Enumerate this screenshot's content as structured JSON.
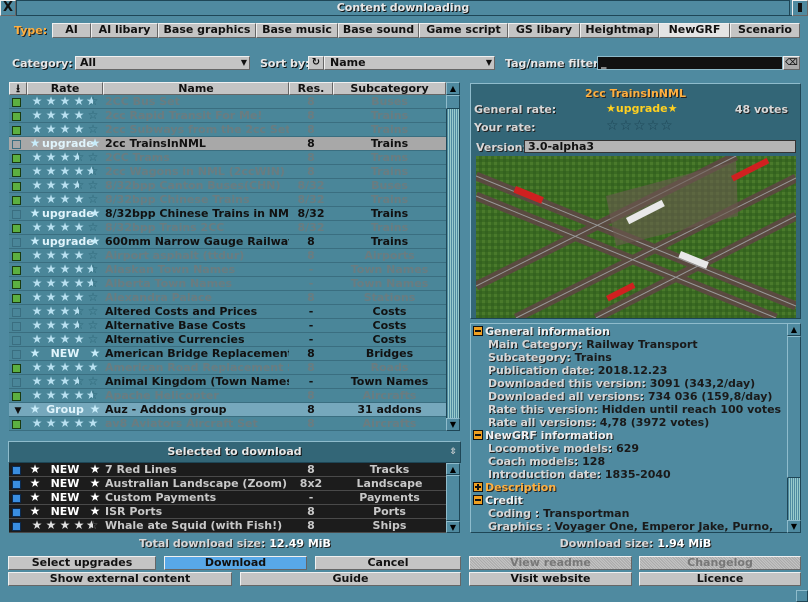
{
  "window": {
    "title": "Content downloading",
    "close": "X"
  },
  "type": {
    "label": "Type:",
    "tabs": [
      "AI",
      "AI libary",
      "Base graphics",
      "Base music",
      "Base sound",
      "Game script",
      "GS libary",
      "Heightmap",
      "NewGRF",
      "Scenario"
    ],
    "active": "NewGRF"
  },
  "filters": {
    "category_label": "Category:",
    "category_value": "All",
    "sort_label": "Sort by:",
    "sort_value": "Name",
    "filter_label": "Tag/name filter:",
    "filter_value": "_"
  },
  "list": {
    "headers": {
      "download": "⭳",
      "rate": "Rate",
      "name": "Name",
      "res": "Res.",
      "sub": "Subcategory"
    },
    "rows": [
      {
        "check": "green",
        "state": "inst",
        "rating": 4.5,
        "name": "2CC Bus Set",
        "res": "8",
        "sub": "Buses"
      },
      {
        "check": "green",
        "state": "inst",
        "rating": 4,
        "name": "2cc Rapid Transit For Me!",
        "res": "8",
        "sub": "Trains"
      },
      {
        "check": "green",
        "state": "inst",
        "rating": 4,
        "name": "2cc Subways from the 2cc Set",
        "res": "8",
        "sub": "Trains"
      },
      {
        "check": "none",
        "state": "sel",
        "badge": "upgrade",
        "name": "2cc TrainsInNML",
        "res": "8",
        "sub": "Trains"
      },
      {
        "check": "green",
        "state": "inst",
        "rating": 3.5,
        "name": "2CC Trams",
        "res": "8",
        "sub": "Trams"
      },
      {
        "check": "green",
        "state": "inst",
        "rating": 4.5,
        "name": "2cc Wagons in NML (2ccWIN)",
        "res": "8",
        "sub": "Trains"
      },
      {
        "check": "green",
        "state": "inst",
        "rating": 3.5,
        "name": "8/32bpp Canton Buses(CHN)",
        "res": "8/32",
        "sub": "Buses"
      },
      {
        "check": "green",
        "state": "inst",
        "rating": 4,
        "name": "8/32bpp Chinese Trains",
        "res": "8/32",
        "sub": "Trains"
      },
      {
        "check": "none",
        "state": "avail",
        "badge": "upgrade",
        "name": "8/32bpp Chinese Trains in NML",
        "res": "8/32",
        "sub": "Trains"
      },
      {
        "check": "green",
        "state": "inst",
        "rating": 4,
        "name": "8/32bpp Trains 2CC",
        "res": "8/32",
        "sub": "Trains"
      },
      {
        "check": "none",
        "state": "avail",
        "badge": "upgrade",
        "name": "600mm Narrow Gauge Railways",
        "res": "8",
        "sub": "Trains"
      },
      {
        "check": "green",
        "state": "inst",
        "rating": 4,
        "name": "Airport asphalt (ttdur)",
        "res": "8",
        "sub": "Airports"
      },
      {
        "check": "green",
        "state": "inst",
        "rating": 4.5,
        "name": "Alaskan Town Names",
        "res": "-",
        "sub": "Town Names"
      },
      {
        "check": "green",
        "state": "inst",
        "rating": 4.5,
        "name": "Alberta Town Names",
        "res": "-",
        "sub": "Town Names"
      },
      {
        "check": "green",
        "state": "inst",
        "rating": 4,
        "name": "Alexandra Palace",
        "res": "8",
        "sub": "Stations"
      },
      {
        "check": "none",
        "state": "avail",
        "rating": 3.5,
        "name": "Altered Costs and Prices",
        "res": "-",
        "sub": "Costs"
      },
      {
        "check": "none",
        "state": "avail",
        "rating": 3.5,
        "name": "Alternative Base Costs",
        "res": "-",
        "sub": "Costs"
      },
      {
        "check": "none",
        "state": "avail",
        "rating": 4,
        "name": "Alternative Currencies",
        "res": "-",
        "sub": "Costs"
      },
      {
        "check": "none",
        "state": "avail",
        "badge": "NEW",
        "name": "American Bridge Replacement Set",
        "res": "8",
        "sub": "Bridges"
      },
      {
        "check": "green",
        "state": "inst",
        "rating": 5,
        "name": "American Road Replacement Set",
        "res": "8",
        "sub": "Roads"
      },
      {
        "check": "none",
        "state": "avail",
        "rating": 3.5,
        "name": "Animal Kingdom (Town Names)",
        "res": "-",
        "sub": "Town Names"
      },
      {
        "check": "green",
        "state": "inst",
        "rating": 4.5,
        "name": "Apache Helicopter",
        "res": "8",
        "sub": "Aircrafts"
      },
      {
        "check": "group",
        "state": "grp",
        "badge": "Group",
        "name": "Auz - Addons group",
        "res": "8",
        "sub": "31 addons"
      },
      {
        "check": "green",
        "state": "inst",
        "rating": 5,
        "name": "av8 Aviators Aircraft Set",
        "res": "8",
        "sub": "Aircrafts"
      }
    ]
  },
  "selected": {
    "title": "Selected to download",
    "rows": [
      {
        "check": "blue",
        "badge": "NEW",
        "name": "7 Red Lines",
        "res": "8",
        "sub": "Tracks"
      },
      {
        "check": "blue",
        "badge": "NEW",
        "name": "Australian Landscape (Zoom)",
        "res": "8x2",
        "sub": "Landscape"
      },
      {
        "check": "blue",
        "badge": "NEW",
        "name": "Custom Payments",
        "res": "-",
        "sub": "Payments"
      },
      {
        "check": "blue",
        "badge": "NEW",
        "name": "ISR Ports",
        "res": "8",
        "sub": "Ports"
      },
      {
        "check": "blue",
        "rating": 4.5,
        "name": "Whale ate Squid (with Fish!)",
        "res": "8",
        "sub": "Ships"
      }
    ],
    "total_label": "Total download size:",
    "total_value": "12.49 MiB"
  },
  "details": {
    "title": "2cc TrainsInNML",
    "general_rate_label": "General rate:",
    "general_rate_badge": "upgrade",
    "votes": "48 votes",
    "your_rate_label": "Your rate:",
    "your_rate": 0,
    "version_label": "Version:",
    "version_value": "3.0-alpha3",
    "sections": [
      {
        "title": "General information",
        "expanded": true,
        "items": [
          {
            "k": "Main Category:",
            "v": "Railway Transport"
          },
          {
            "k": "Subcategory:",
            "v": "Trains"
          },
          {
            "k": "Publication date:",
            "v": "2018.12.23"
          },
          {
            "k": "Downloaded this version:",
            "v": "3091 (343,2/day)"
          },
          {
            "k": "Downloaded all versions:",
            "v": "734 036 (159,8/day)"
          },
          {
            "k": "Rate this version:",
            "v": "Hidden until reach 100 votes"
          },
          {
            "k": "Rate all versions:",
            "v": "4,78 (3972 votes)"
          }
        ]
      },
      {
        "title": "NewGRF information",
        "expanded": true,
        "items": [
          {
            "k": "Locomotive models:",
            "v": "629"
          },
          {
            "k": "Coach models:",
            "v": "128"
          },
          {
            "k": "Introduction date:",
            "v": "1835-2040"
          }
        ]
      },
      {
        "title": "Description",
        "expanded": false,
        "items": []
      },
      {
        "title": "Credit",
        "expanded": true,
        "items": [
          {
            "k": "Coding :",
            "v": "Transportman"
          },
          {
            "k": "Graphics :",
            "v": "Voyager One, Emperor Jake, Purno,"
          }
        ]
      }
    ],
    "size_label": "Download size:",
    "size_value": "1.94 MiB"
  },
  "buttons": {
    "select_upgrades": "Select upgrades",
    "download": "Download",
    "cancel": "Cancel",
    "show_external": "Show external content",
    "guide": "Guide",
    "view_readme": "View readme",
    "changelog": "Changelog",
    "visit_website": "Visit website",
    "licence": "Licence"
  },
  "colors": {
    "window": "#4f8aa0",
    "accent": "#ffb040",
    "download_button": "#58a8e8",
    "installed_text": "#6a7c80"
  }
}
